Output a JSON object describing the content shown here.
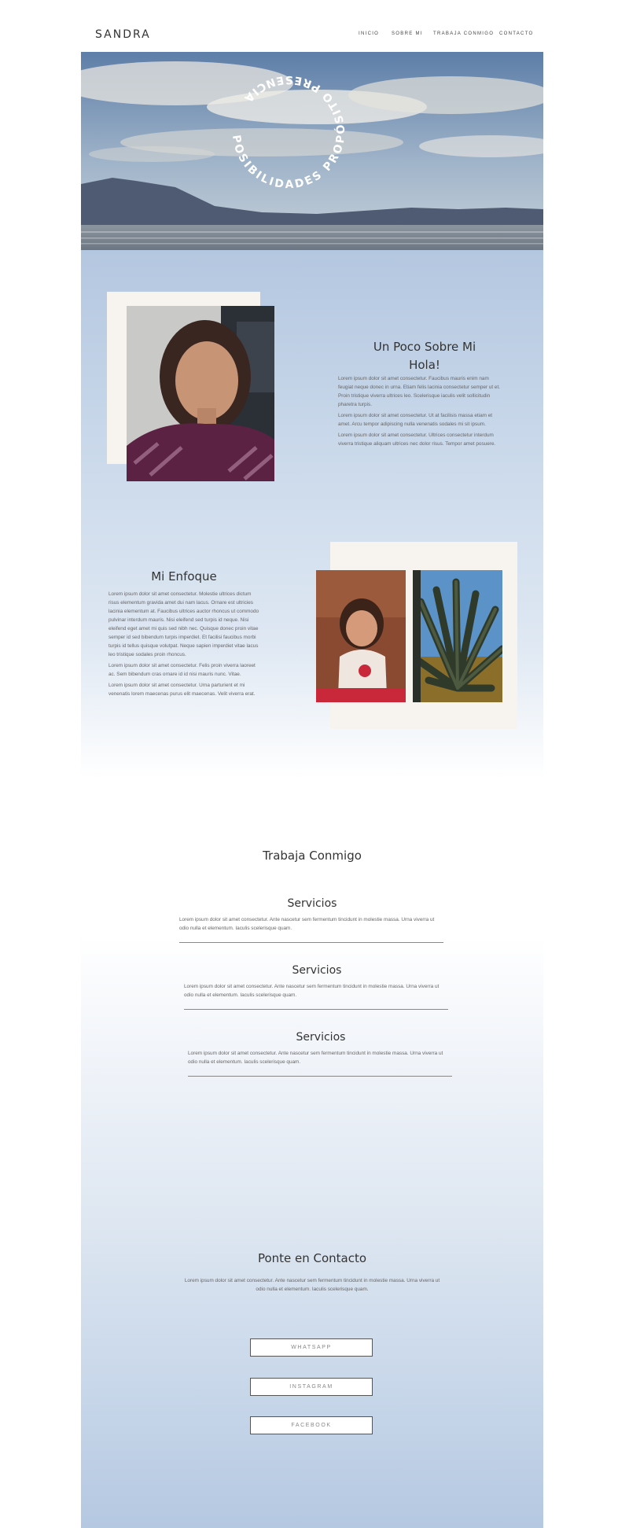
{
  "header": {
    "brand": "SANDRA",
    "nav": [
      "INICIO",
      "SOBRE MI",
      "TRABAJA CONMIGO",
      "CONTACTO"
    ]
  },
  "hero": {
    "circle_text": "POSIBILIDADES PROPÓSITO PRESENCIA"
  },
  "about": {
    "title_line1": "Un Poco Sobre Mi",
    "title_line2": "Hola!",
    "paragraphs": [
      "Lorem ipsum dolor sit amet consectetur. Faucibus mauris enim nam feugiat neque donec in urna. Etiam felis lacinia consectetur semper ut et. Proin tristique viverra ultrices leo. Scelerisque iaculis velit sollicitudin pharetra turpis.",
      "Lorem ipsum dolor sit amet consectetur. Ut at facilisis massa etiam et amet. Arcu tempor adipiscing nulla venenatis sodales mi sit ipsum.",
      "Lorem ipsum dolor sit amet consectetur. Ultrices consectetur interdum viverra tristique aliquam ultrices nec dolor risus. Tempor amet posuere."
    ]
  },
  "focus": {
    "title": "Mi Enfoque",
    "paragraphs": [
      "Lorem ipsum dolor sit amet consectetur. Molestie ultrices dictum risus elementum gravida amet dui nam lacus. Ornare est ultricies lacinia elementum at. Faucibus ultrices auctor rhoncus ut commodo pulvinar interdum mauris. Nisi eleifend sed turpis id neque. Nisi eleifend eget amet mi quis sed nibh nec. Quisque donec proin vitae semper id sed bibendum turpis imperdiet. Et facilisi faucibus morbi turpis id tellus quisque volutpat. Neque sapien imperdiet vitae lacus leo tristique sodales proin rhoncus.",
      "Lorem ipsum dolor sit amet consectetur. Felis proin viverra laoreet ac. Sem bibendum cras ornare id id nisi mauris nunc. Vitae.",
      "Lorem ipsum dolor sit amet consectetur. Urna parturient et mi venenatis lorem maecenas purus elit maecenas. Velit viverra erat."
    ]
  },
  "work": {
    "title": "Trabaja Conmigo",
    "services": [
      {
        "title": "Servicios",
        "text": "Lorem ipsum dolor sit amet consectetur. Ante nascetur sem fermentum tincidunt in molestie massa. Urna viverra ut odio nulla et elementum. Iaculis scelerisque quam."
      },
      {
        "title": "Servicios",
        "text": "Lorem ipsum dolor sit amet consectetur. Ante nascetur sem fermentum tincidunt in molestie massa. Urna viverra ut odio nulla et elementum. Iaculis scelerisque quam."
      },
      {
        "title": "Servicios",
        "text": "Lorem ipsum dolor sit amet consectetur. Ante nascetur sem fermentum tincidunt in molestie massa. Urna viverra ut odio nulla et elementum. Iaculis scelerisque quam."
      }
    ]
  },
  "contact": {
    "title": "Ponte en Contacto",
    "text": "Lorem ipsum dolor sit amet consectetur. Ante nascetur sem fermentum tincidunt in molestie massa. Urna viverra ut odio nulla et elementum. Iaculis scelerisque quam.",
    "buttons": [
      "WHATSAPP",
      "INSTAGRAM",
      "FACEBOOK"
    ]
  },
  "colors": {
    "panel_top": "#b4c7e0",
    "frame": "#f7f3ee",
    "text": "#333333"
  }
}
